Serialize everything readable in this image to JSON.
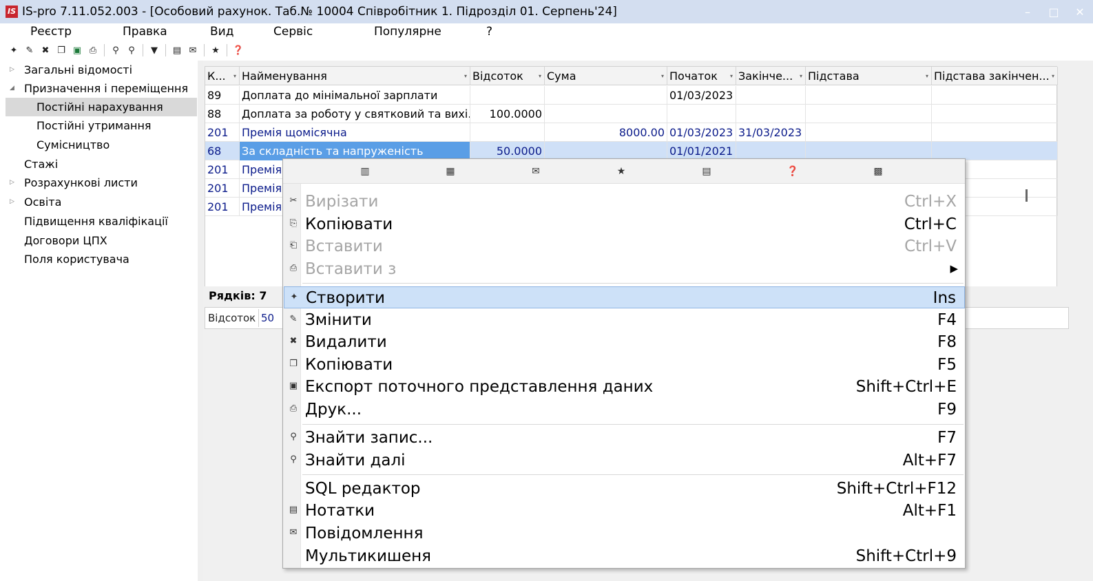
{
  "window": {
    "logo": "IS",
    "title": "IS-pro 7.11.052.003 - [Особовий рахунок. Таб.№ 10004 Співробітник 1. Підрозділ 01. Серпень'24]",
    "controls": [
      "–",
      "□",
      "✕"
    ]
  },
  "menubar": [
    "Реєстр",
    "Правка",
    "Вид",
    "Сервіс",
    "Популярне",
    "?"
  ],
  "toolbar_icons": [
    "new-icon",
    "edit-icon",
    "delete-icon",
    "copy-icon",
    "excel-export-icon",
    "print-icon",
    "find-icon",
    "find-next-icon",
    "filter-icon",
    "notes-icon",
    "mail-icon",
    "star-icon",
    "help-icon"
  ],
  "tree": [
    {
      "label": "Загальні відомості",
      "expander": "▷"
    },
    {
      "label": "Призначення і переміщення",
      "expander": "◢"
    },
    {
      "label": "Постійні нарахування",
      "selected": true
    },
    {
      "label": "Постійні утримання"
    },
    {
      "label": "Сумісництво"
    },
    {
      "label": "Стажі"
    },
    {
      "label": "Розрахункові листи",
      "expander": "▷"
    },
    {
      "label": "Освіта",
      "expander": "▷"
    },
    {
      "label": "Підвищення кваліфікації"
    },
    {
      "label": "Договори ЦПХ"
    },
    {
      "label": "Поля користувача"
    }
  ],
  "grid": {
    "columns": [
      "К...",
      "Найменування",
      "Відсоток",
      "Сума",
      "Початок",
      "Закінче...",
      "Підстава",
      "Підстава закінчен..."
    ],
    "dropdown_glyph": "▾",
    "rows": [
      {
        "code": "89",
        "name": "Доплата до мінімальної  зарплати",
        "percent": "",
        "sum": "",
        "start": "01/03/2023",
        "end": "",
        "basis": "",
        "basis_end": "",
        "style": "normal"
      },
      {
        "code": "88",
        "name": "Доплата за роботу у святковий та вихі...",
        "percent": "100.0000",
        "sum": "",
        "start": "",
        "end": "",
        "basis": "",
        "basis_end": "",
        "style": "normal"
      },
      {
        "code": "201",
        "name": "Премія щомісячна",
        "percent": "",
        "sum": "8000.00",
        "start": "01/03/2023",
        "end": "31/03/2023",
        "basis": "",
        "basis_end": "",
        "style": "blue"
      },
      {
        "code": "68",
        "name": "За складність та напруженість",
        "percent": "50.0000",
        "sum": "",
        "start": "01/01/2021",
        "end": "",
        "basis": "",
        "basis_end": "",
        "style": "selected"
      },
      {
        "code": "201",
        "name": "Премія",
        "percent": "",
        "sum": "",
        "start": "",
        "end": "",
        "basis": "",
        "basis_end": "",
        "style": "blue"
      },
      {
        "code": "201",
        "name": "Премія",
        "percent": "",
        "sum": "",
        "start": "",
        "end": "",
        "basis": "",
        "basis_end": "",
        "style": "blue"
      },
      {
        "code": "201",
        "name": "Премія",
        "percent": "",
        "sum": "",
        "start": "",
        "end": "",
        "basis": "",
        "basis_end": "",
        "style": "blue"
      }
    ]
  },
  "rows_count": "Рядків: 7",
  "percent_field": {
    "label": "Відсоток",
    "value": "50"
  },
  "context_menu": {
    "toolbar_icons": [
      "calculator-icon",
      "calendar-icon",
      "mail-icon",
      "star-icon",
      "notes-icon",
      "help-icon",
      "pockets-icon"
    ],
    "toolbar_glyphs": [
      "▥",
      "▦",
      "✉",
      "★",
      "▤",
      "❓",
      "▩"
    ],
    "items": [
      {
        "label": "Вирізати",
        "shortcut": "Ctrl+X",
        "icon": "cut-icon",
        "glyph": "✂",
        "disabled": true
      },
      {
        "label": "Копіювати",
        "shortcut": "Ctrl+C",
        "icon": "copy-icon",
        "glyph": "⎘"
      },
      {
        "label": "Вставити",
        "shortcut": "Ctrl+V",
        "icon": "paste-icon",
        "glyph": "⎗",
        "disabled": true
      },
      {
        "label": "Вставити з",
        "shortcut": "",
        "icon": "paste-from-icon",
        "glyph": "⎙",
        "disabled": true,
        "submenu": true,
        "sep_after": true
      },
      {
        "label": "Створити",
        "shortcut": "Ins",
        "icon": "new-icon",
        "glyph": "✦",
        "highlighted": true
      },
      {
        "label": "Змінити",
        "shortcut": "F4",
        "icon": "edit-icon",
        "glyph": "✎"
      },
      {
        "label": "Видалити",
        "shortcut": "F8",
        "icon": "delete-icon",
        "glyph": "✖"
      },
      {
        "label": "Копіювати",
        "shortcut": "F5",
        "icon": "copy-record-icon",
        "glyph": "❐"
      },
      {
        "label": "Експорт поточного представлення даних",
        "shortcut": "Shift+Ctrl+E",
        "icon": "excel-export-icon",
        "glyph": "▣"
      },
      {
        "label": "Друк...",
        "shortcut": "F9",
        "icon": "print-icon",
        "glyph": "⎙",
        "sep_after": true
      },
      {
        "label": "Знайти запис...",
        "shortcut": "F7",
        "icon": "find-icon",
        "glyph": "⚲"
      },
      {
        "label": "Знайти далі",
        "shortcut": "Alt+F7",
        "icon": "find-next-icon",
        "glyph": "⚲",
        "sep_after": true
      },
      {
        "label": "SQL редактор",
        "shortcut": "Shift+Ctrl+F12",
        "icon": "",
        "glyph": ""
      },
      {
        "label": "Нотатки",
        "shortcut": "Alt+F1",
        "icon": "notes-icon",
        "glyph": "▤"
      },
      {
        "label": "Повідомлення",
        "shortcut": "",
        "icon": "mail-icon",
        "glyph": "✉"
      },
      {
        "label": "Мультикишеня",
        "shortcut": "Shift+Ctrl+9",
        "icon": "",
        "glyph": ""
      }
    ]
  },
  "colors": {
    "titlebar": "#d3def0",
    "selection": "#5a9ee6",
    "selected_row": "#cfe0f7",
    "blue_text": "#0a1a8a",
    "menu_highlight": "#cde1f8"
  }
}
